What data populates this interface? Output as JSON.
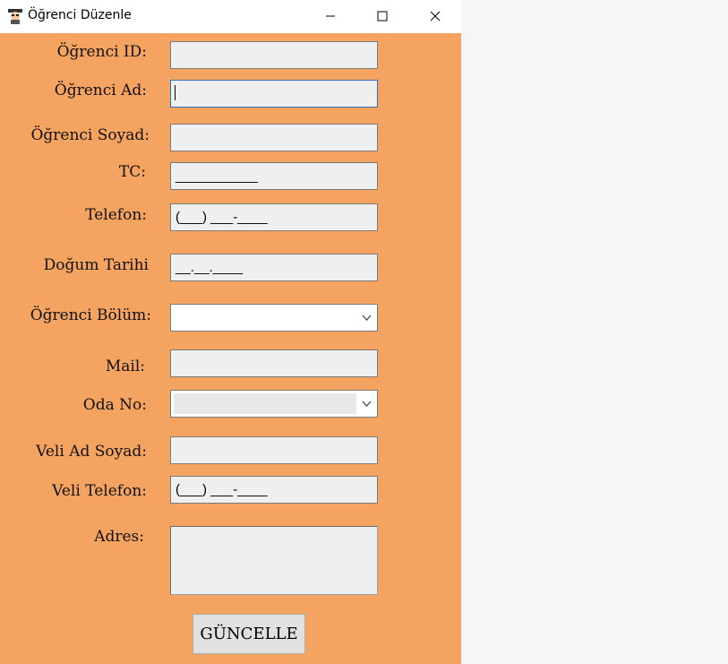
{
  "window": {
    "title": "Öğrenci Düzenle",
    "app_icon": "student-avatar-icon"
  },
  "form": {
    "labels": {
      "id": "Öğrenci ID:",
      "ad": "Öğrenci Ad:",
      "soyad": "Öğrenci Soyad:",
      "tc": "TC:",
      "telefon": "Telefon:",
      "dogum": "Doğum Tarihi",
      "bolum": "Öğrenci Bölüm:",
      "mail": "Mail:",
      "oda": "Oda No:",
      "veli_ad": "Veli Ad Soyad:",
      "veli_tel": "Veli Telefon:",
      "adres": "Adres:"
    },
    "masks": {
      "tc": "___________",
      "telefon": "(___) ___-____",
      "dogum": "__.__.____",
      "veli_tel": "(___) ___-____"
    },
    "values": {
      "id": "",
      "ad": "",
      "soyad": "",
      "mail": "",
      "veli_ad": "",
      "adres": "",
      "bolum": "",
      "oda": ""
    },
    "submit_label": "GÜNCELLE"
  },
  "colors": {
    "form_background": "#f4a460",
    "field_background": "#efefef"
  }
}
